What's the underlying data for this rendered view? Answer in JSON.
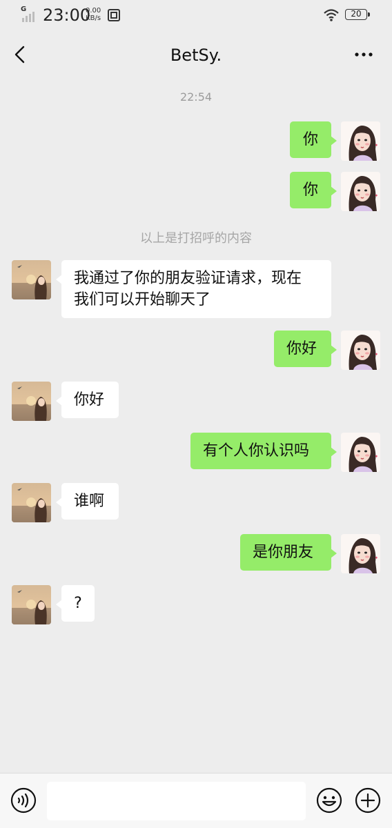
{
  "status_bar": {
    "network": "G",
    "time": "23:00",
    "speed_value": "0.00",
    "speed_unit": "KB/s",
    "battery": "20"
  },
  "header": {
    "title": "BetSy."
  },
  "chat": {
    "timestamp": "22:54",
    "greeting_note": "以上是打招呼的内容",
    "messages": [
      {
        "from": "me",
        "text": "你"
      },
      {
        "from": "me",
        "text": "你"
      },
      {
        "from": "them",
        "line1": "我通过了你的朋友验证请求，现在",
        "line2": "我们可以开始聊天了"
      },
      {
        "from": "me",
        "text": "你好"
      },
      {
        "from": "them",
        "text": "你好"
      },
      {
        "from": "me",
        "text": "有个人你认识吗"
      },
      {
        "from": "them",
        "text": "谁啊"
      },
      {
        "from": "me",
        "text": "是你朋友"
      },
      {
        "from": "them",
        "text": "?"
      }
    ]
  },
  "input_bar": {
    "value": "",
    "voice_icon": "voice-icon",
    "emoji_icon": "emoji-icon",
    "plus_icon": "plus-icon"
  },
  "colors": {
    "background": "#ededed",
    "outgoing_bubble": "#95ec69",
    "incoming_bubble": "#ffffff"
  }
}
